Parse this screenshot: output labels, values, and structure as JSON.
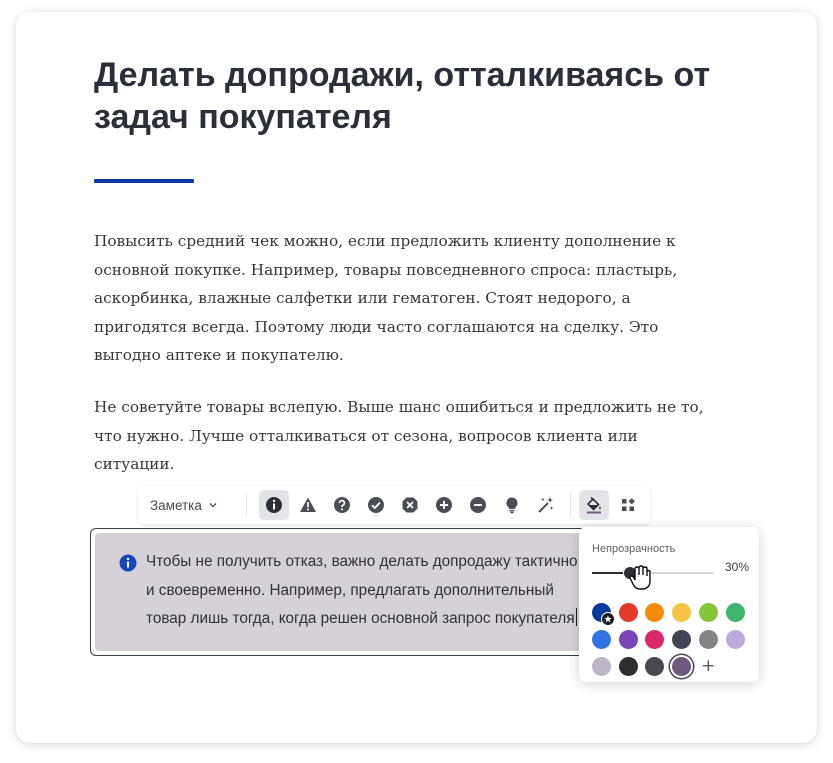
{
  "article": {
    "title": "Делать допродажи, отталкиваясь от задач покупателя",
    "paragraphs": [
      "Повысить средний чек можно, если предложить клиенту дополнение к основной покупке. Например, товары повседневного спроса: пластырь, аскорбинка, влажные салфетки или гематоген. Стоят недорого, а пригодятся всегда. Поэтому люди часто соглашаются на сделку. Это выгодно аптеке и покупателю.",
      "Не советуйте товары вслепую. Выше шанс ошибиться и предложить не то, что нужно. Лучше отталкиваться от сезона, вопросов клиента или ситуации."
    ],
    "accent_color": "#0b3a9e"
  },
  "toolbar": {
    "block_type_label": "Заметка",
    "icons": [
      "info-icon",
      "warning-icon",
      "question-icon",
      "check-icon",
      "cross-icon",
      "plus-circle-icon",
      "minus-circle-icon",
      "lightbulb-icon",
      "sparkle-icon",
      "fill-color-icon",
      "more-grid-icon"
    ],
    "active_icon": "info-icon"
  },
  "note": {
    "text": "Чтобы не получить отказ, важно делать допродажу тактично и своевременно. Например, предлагать дополнительный товар лишь тогда, когда решен основной запрос покупателя",
    "background": "#d6d1d9"
  },
  "color_popover": {
    "opacity_label": "Непрозрачность",
    "opacity_value": "30%",
    "opacity": 0.3,
    "colors": [
      "#0b3a9e",
      "#e23a2c",
      "#f58a0b",
      "#f6c344",
      "#86c63c",
      "#3cb46e",
      "#2f74e0",
      "#7b44b8",
      "#d9286b",
      "#414652",
      "#858585",
      "#bfa9d9",
      "#bdb4c6",
      "#2c2d2f",
      "#4b4751",
      "#6e5a7c"
    ],
    "default_color": "#0b3a9e",
    "selected_color": "#6e5a7c",
    "add_label": "+"
  }
}
